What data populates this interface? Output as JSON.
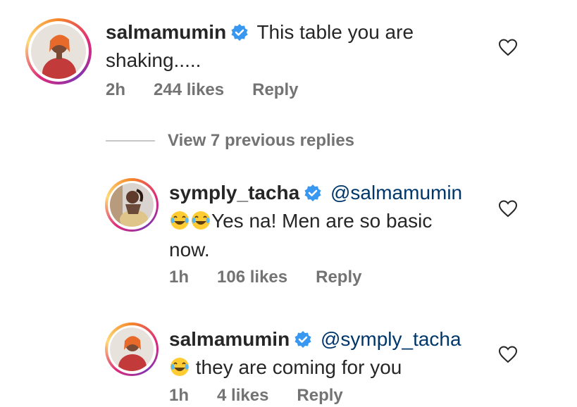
{
  "comments": [
    {
      "username": "salmamumin",
      "mention": "",
      "text": "This table you are shaking.....",
      "text_line1": "This table you are",
      "text_line2": "shaking.....",
      "time": "2h",
      "likes": "244 likes",
      "reply": "Reply"
    },
    {
      "username": "symply_tacha",
      "mention": "@salmamumin",
      "text_line1": "Yes na! Men are so basic",
      "text_line2": "now.",
      "emoji": "joy-emoji x2",
      "time": "1h",
      "likes": "106 likes",
      "reply": "Reply"
    },
    {
      "username": "salmamumin",
      "mention": "@symply_tacha",
      "text_line1": " they are coming for you",
      "emoji": "joy-emoji",
      "time": "1h",
      "likes": "4 likes",
      "reply": "Reply"
    }
  ],
  "view_replies": "View 7 previous replies",
  "icons": {
    "verified": "verified-badge-icon",
    "like": "heart-outline-icon"
  },
  "colors": {
    "verified": "#3897f0",
    "text": "#262626",
    "meta": "#737373",
    "mention": "#00376b"
  }
}
